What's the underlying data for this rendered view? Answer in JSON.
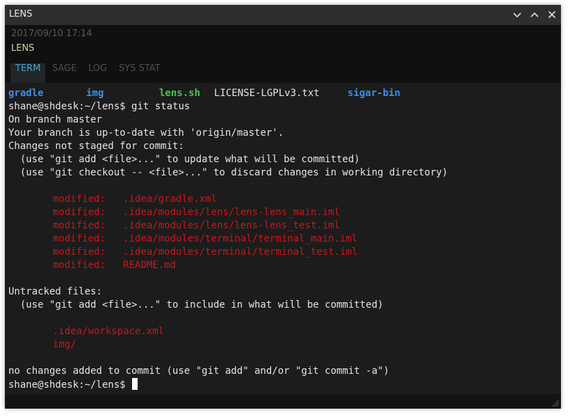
{
  "window": {
    "title": "LENS",
    "buttons": [
      "minimize",
      "maximize",
      "close"
    ]
  },
  "header": {
    "datetime": "2017/09/10 17:14",
    "app_name": "LENS",
    "tabs": [
      {
        "label": "TERM",
        "active": true
      },
      {
        "label": "SAGE",
        "active": false
      },
      {
        "label": "LOG",
        "active": false
      },
      {
        "label": "SYS STAT",
        "active": false
      }
    ]
  },
  "terminal": {
    "ls_items": [
      {
        "name": "gradle",
        "color": "#3b8eea"
      },
      {
        "name": "img",
        "color": "#3b8eea"
      },
      {
        "name": "lens.sh",
        "color": "#4ec24e"
      },
      {
        "name": "LICENSE-LGPLv3.txt",
        "color": "#e6e6e6"
      },
      {
        "name": "sigar-bin",
        "color": "#3b8eea"
      }
    ],
    "prompt": "shane@shdesk:~/lens$ ",
    "command": "git status",
    "on_branch": "On branch master",
    "up_to_date": "Your branch is up-to-date with 'origin/master'.",
    "changes_header": "Changes not staged for commit:",
    "hint_add": "  (use \"git add <file>...\" to update what will be committed)",
    "hint_checkout": "  (use \"git checkout -- <file>...\" to discard changes in working directory)",
    "modified_prefix": "modified:   ",
    "modified_files": [
      ".idea/gradle.xml",
      ".idea/modules/lens/lens-lens_main.iml",
      ".idea/modules/lens/lens-lens_test.iml",
      ".idea/modules/terminal/terminal_main.iml",
      ".idea/modules/terminal/terminal_test.iml",
      "README.md"
    ],
    "untracked_header": "Untracked files:",
    "untracked_hint": "  (use \"git add <file>...\" to include in what will be committed)",
    "untracked_files": [
      ".idea/workspace.xml",
      "img/"
    ],
    "summary": "no changes added to commit (use \"git add\" and/or \"git commit -a\")",
    "final_prompt": "shane@shdesk:~/lens$ "
  },
  "colors": {
    "directory": "#3b8eea",
    "executable": "#4ec24e",
    "git_changed": "#c8171c",
    "active_tab": "#4aa3c8"
  }
}
